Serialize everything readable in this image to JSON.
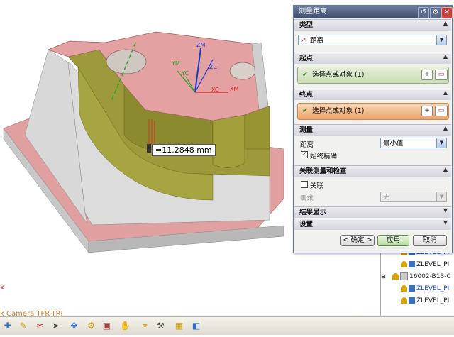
{
  "viewport": {
    "measurement_label": "=11.2848 mm",
    "camera_text": "k Camera TFR-TRI",
    "x_mark": "x",
    "axes": {
      "zm": "ZM",
      "zc": "ZC",
      "ym": "YM",
      "yc": "YC",
      "xc": "XC",
      "xm": "XM"
    }
  },
  "dialog": {
    "title": "测量距离",
    "type_section": {
      "header": "类型",
      "value": "距离"
    },
    "start_section": {
      "header": "起点",
      "select_text": "选择点或对象 (1)"
    },
    "end_section": {
      "header": "终点",
      "select_text": "选择点或对象 (1)"
    },
    "measure_section": {
      "header": "测量",
      "distance_label": "距离",
      "distance_value": "最小值",
      "precise_label": "始终精确",
      "precise_checked": true
    },
    "assoc_section": {
      "header": "关联测量和检查",
      "assoc_label": "关联",
      "assoc_checked": false,
      "req_label": "需求",
      "req_value": "无"
    },
    "result_section": {
      "header": "结果显示"
    },
    "settings_section": {
      "header": "设置"
    },
    "buttons": {
      "ok": "< 确定 >",
      "apply": "应用",
      "cancel": "取消"
    }
  },
  "tree": {
    "items": [
      {
        "label": "ZLEVEL_PI",
        "style": "blue"
      },
      {
        "label": "ZLEVEL_PI",
        "style": "dark"
      },
      {
        "label": "16002-B13-C",
        "style": "dark"
      },
      {
        "label": "ZLEVEL_PI",
        "style": "blue"
      },
      {
        "label": "ZLEVEL_PI",
        "style": "dark"
      }
    ]
  },
  "colors": {
    "title_bar": "#4e5d7e",
    "pink_face": "#e3a1a2",
    "olive_face": "#9c9a3a",
    "end_point_highlight": "#f0a860",
    "start_point_highlight": "#cfe0b8"
  }
}
